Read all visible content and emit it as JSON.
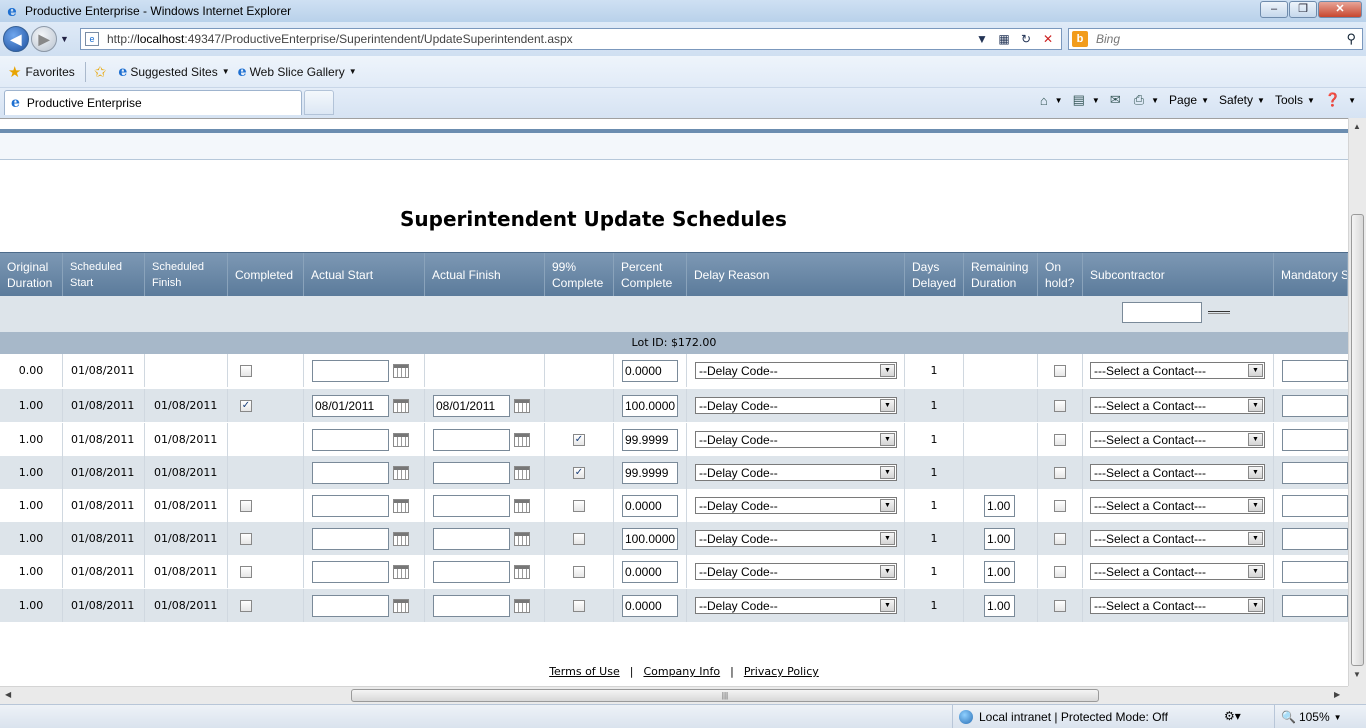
{
  "window": {
    "title": "Productive Enterprise - Windows Internet Explorer",
    "minimize": "‒",
    "restore": "❐",
    "close": "✕"
  },
  "address": {
    "url_prefix": "http://",
    "url_host": "localhost",
    "url_rest": ":49347/ProductiveEnterprise/Superintendent/UpdateSuperintendent.aspx",
    "search_placeholder": "Bing"
  },
  "favorites": {
    "favorites_label": "Favorites",
    "suggested_label": "Suggested Sites",
    "webslice_label": "Web Slice Gallery"
  },
  "tabs": {
    "active_label": "Productive Enterprise"
  },
  "commands": {
    "page": "Page",
    "safety": "Safety",
    "tools": "Tools"
  },
  "page": {
    "title": "Superintendent Update Schedules",
    "group_label": "Lot ID: $172.00"
  },
  "headers": {
    "original_duration": "Original Duration",
    "scheduled_start": "Scheduled Start",
    "scheduled_finish": "Scheduled Finish",
    "completed": "Completed",
    "actual_start": "Actual Start",
    "actual_finish": "Actual Finish",
    "pct99": "99% Complete",
    "percent_complete": "Percent Complete",
    "delay_reason": "Delay Reason",
    "days_delayed": "Days Delayed",
    "remaining_duration": "Remaining Duration",
    "on_hold": "On hold?",
    "subcontractor": "Subcontractor",
    "mandatory": "Mandatory S"
  },
  "rows": [
    {
      "orig": "0.00",
      "sstart": "01/08/2011",
      "sfinish": "",
      "completed": false,
      "astart": "",
      "afinish": null,
      "pct99": null,
      "percent": "0.0000",
      "delay": "--Delay Code--",
      "days": "1",
      "remaining": null,
      "onhold": false,
      "sub": "---Select a Contact---"
    },
    {
      "orig": "1.00",
      "sstart": "01/08/2011",
      "sfinish": "01/08/2011",
      "completed": true,
      "astart": "08/01/2011",
      "afinish": "08/01/2011",
      "pct99": null,
      "percent": "100.0000",
      "delay": "--Delay Code--",
      "days": "1",
      "remaining": null,
      "onhold": false,
      "sub": "---Select a Contact---"
    },
    {
      "orig": "1.00",
      "sstart": "01/08/2011",
      "sfinish": "01/08/2011",
      "completed": null,
      "astart": "",
      "afinish": "",
      "pct99": true,
      "percent": "99.9999",
      "delay": "--Delay Code--",
      "days": "1",
      "remaining": null,
      "onhold": false,
      "sub": "---Select a Contact---"
    },
    {
      "orig": "1.00",
      "sstart": "01/08/2011",
      "sfinish": "01/08/2011",
      "completed": null,
      "astart": "",
      "afinish": "",
      "pct99": true,
      "percent": "99.9999",
      "delay": "--Delay Code--",
      "days": "1",
      "remaining": null,
      "onhold": false,
      "sub": "---Select a Contact---"
    },
    {
      "orig": "1.00",
      "sstart": "01/08/2011",
      "sfinish": "01/08/2011",
      "completed": false,
      "astart": "",
      "afinish": "",
      "pct99": false,
      "percent": "0.0000",
      "delay": "--Delay Code--",
      "days": "1",
      "remaining": "1.00",
      "onhold": false,
      "sub": "---Select a Contact---"
    },
    {
      "orig": "1.00",
      "sstart": "01/08/2011",
      "sfinish": "01/08/2011",
      "completed": false,
      "astart": "",
      "afinish": "",
      "pct99": false,
      "percent": "100.0000",
      "delay": "--Delay Code--",
      "days": "1",
      "remaining": "1.00",
      "onhold": false,
      "sub": "---Select a Contact---"
    },
    {
      "orig": "1.00",
      "sstart": "01/08/2011",
      "sfinish": "01/08/2011",
      "completed": false,
      "astart": "",
      "afinish": "",
      "pct99": false,
      "percent": "0.0000",
      "delay": "--Delay Code--",
      "days": "1",
      "remaining": "1.00",
      "onhold": false,
      "sub": "---Select a Contact---"
    },
    {
      "orig": "1.00",
      "sstart": "01/08/2011",
      "sfinish": "01/08/2011",
      "completed": false,
      "astart": "",
      "afinish": "",
      "pct99": false,
      "percent": "0.0000",
      "delay": "--Delay Code--",
      "days": "1",
      "remaining": "1.00",
      "onhold": false,
      "sub": "---Select a Contact---"
    }
  ],
  "footer": {
    "terms": "Terms of Use",
    "company": "Company Info",
    "privacy": "Privacy Policy",
    "sep": "|"
  },
  "status": {
    "zone": "Local intranet | Protected Mode: Off",
    "zoom": "105%"
  },
  "icons": {
    "checkmark": "✓",
    "dropdown": "▼"
  }
}
